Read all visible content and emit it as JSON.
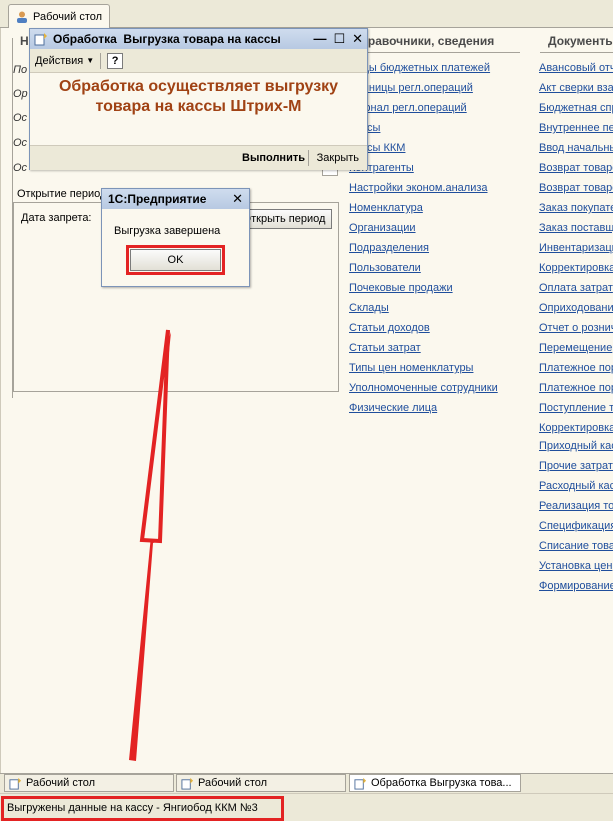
{
  "top_tab": {
    "label": "Рабочий стол"
  },
  "left_column": {
    "header_initial": "Н",
    "items": [
      "По",
      "Ор",
      "Ос",
      "Ос",
      "Ос"
    ]
  },
  "middle_column": {
    "header": "Справочники, сведения",
    "links": [
      "Виды бюджетных платежей",
      "Единицы регл.операций",
      "Журнал регл.операций",
      "Кассы",
      "Кассы ККМ",
      "Контрагенты",
      "Настройки эконом.анализа",
      "Номенклатура",
      "Организации",
      "Подразделения",
      "Пользователи",
      "Почековые продажи",
      "Склады",
      "Статьи доходов",
      "Статьи затрат",
      "Типы цен номенклатуры",
      "Уполномоченные сотрудники",
      "Физические лица"
    ]
  },
  "right_column": {
    "header": "Документы",
    "links": [
      "Авансовый отчет",
      "Акт сверки взаиморасчетов",
      "Бюджетная справка",
      "Внутреннее перемещение",
      "Ввод начальных остатков",
      "Возврат товаров",
      "Возврат товаров поставщику",
      "Заказ покупателя",
      "Заказ поставщику",
      "Инвентаризация",
      "Корректировка",
      "Оплата затрат",
      "Оприходование",
      "Отчет о розничных продажах",
      "Перемещение",
      "Платежное поручение",
      "Платежное поручение",
      "Поступление товаров",
      "Корректировка",
      "Приходный кассовый ордер",
      "Прочие затраты",
      "Расходный кассовый ордер",
      "Реализация товаров",
      "Спецификация",
      "Списание товаров",
      "Установка цен",
      "Формирование"
    ]
  },
  "open_period": {
    "title": "Открытие периода",
    "date_label": "Дата запрета:",
    "button": "Открыть период"
  },
  "processing_window": {
    "title": "Обработка  Выгрузка товара на кассы",
    "actions_label": "Действия",
    "help_label": "?",
    "message_line1": "Обработка осуществляет выгрузку",
    "message_line2": "товара на кассы Штрих-М",
    "execute_button": "Выполнить",
    "close_button": "Закрыть"
  },
  "modal": {
    "title": "1С:Предприятие",
    "message": "Выгрузка завершена",
    "ok_button": "OK"
  },
  "taskbar": {
    "tabs": [
      "Рабочий стол",
      "Рабочий стол",
      "Обработка  Выгрузка това..."
    ]
  },
  "status_bar": {
    "text": "Выгружены данные на кассу - Янгиобод ККМ №3"
  },
  "colors": {
    "accent_red": "#e32323",
    "link_blue": "#1f4e9c",
    "message_brown": "#a04214"
  }
}
